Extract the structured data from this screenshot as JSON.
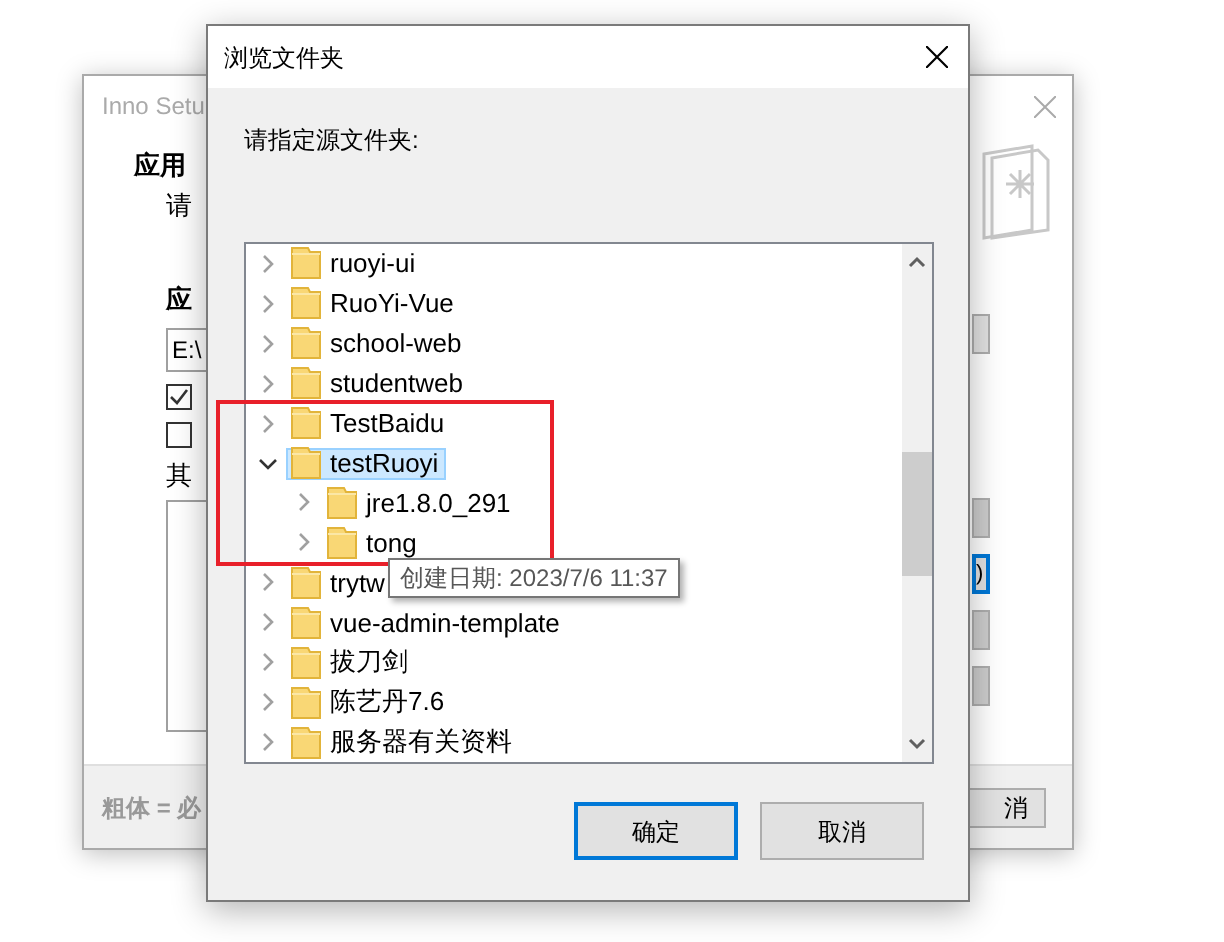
{
  "background_window": {
    "title": "Inno Setu",
    "heading": "应用",
    "subheading": "请",
    "section_label": "应",
    "path_field": {
      "value": "E:\\"
    },
    "checkboxes": [
      {
        "checked": true
      },
      {
        "checked": false
      }
    ],
    "other_label": "其",
    "side_buttons": [
      {
        "focused": false
      },
      {
        "label": ")",
        "focused": true
      },
      {
        "focused": false
      },
      {
        "focused": false
      }
    ],
    "footer": "粗体 = 必",
    "cancel_button": "消"
  },
  "dialog": {
    "title": "浏览文件夹",
    "prompt": "请指定源文件夹:",
    "tree": [
      {
        "label": "ruoyi-ui",
        "expanded": false,
        "selected": false
      },
      {
        "label": "RuoYi-Vue",
        "expanded": false,
        "selected": false
      },
      {
        "label": "school-web",
        "expanded": false,
        "selected": false
      },
      {
        "label": "studentweb",
        "expanded": false,
        "selected": false
      },
      {
        "label": "TestBaidu",
        "expanded": false,
        "selected": false
      },
      {
        "label": "testRuoyi",
        "expanded": true,
        "selected": true,
        "children": [
          {
            "label": "jre1.8.0_291",
            "expanded": false,
            "selected": false
          },
          {
            "label": "tong",
            "expanded": false,
            "selected": false
          }
        ]
      },
      {
        "label": "trytw",
        "expanded": false,
        "selected": false
      },
      {
        "label": "vue-admin-template",
        "expanded": false,
        "selected": false
      },
      {
        "label": "拔刀剑",
        "expanded": false,
        "selected": false
      },
      {
        "label": "陈艺丹7.6",
        "expanded": false,
        "selected": false
      },
      {
        "label": "服务器有关资料",
        "expanded": false,
        "selected": false
      }
    ],
    "tooltip": "创建日期: 2023/7/6 11:37",
    "buttons": [
      {
        "label": "确定",
        "default": true
      },
      {
        "label": "取消",
        "default": false
      }
    ]
  }
}
